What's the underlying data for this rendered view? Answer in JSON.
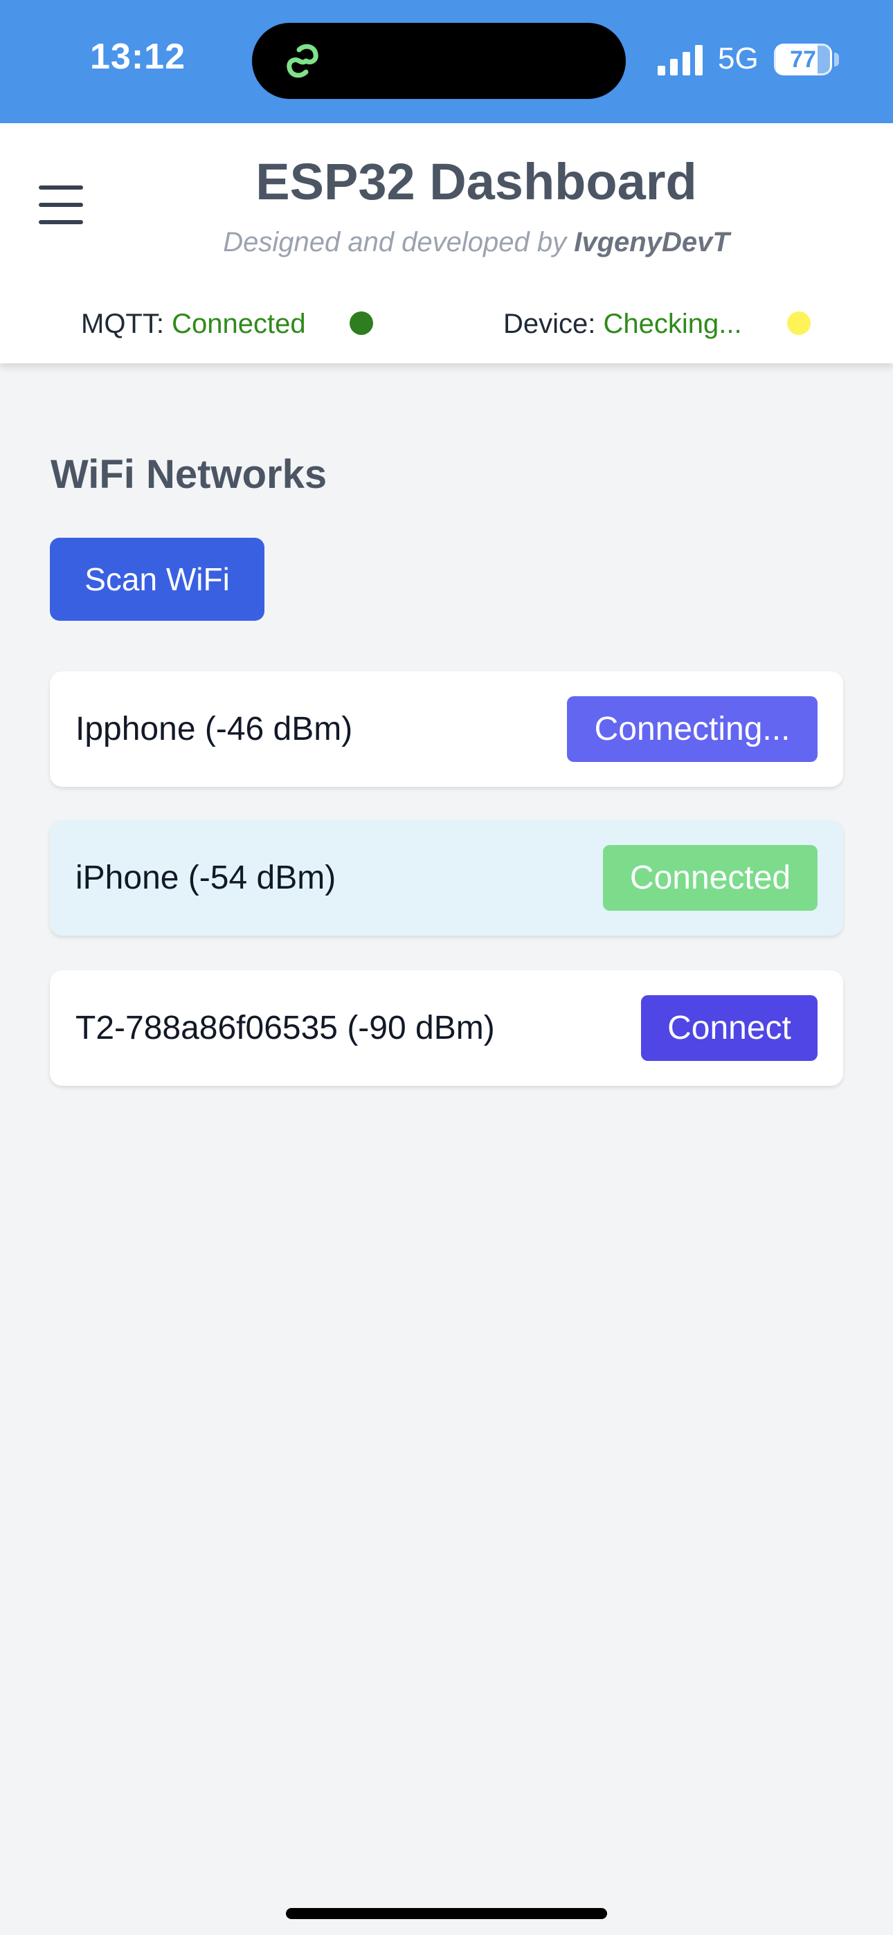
{
  "status_bar": {
    "time": "13:12",
    "network_type": "5G",
    "battery_level": "77",
    "signal_bars": 4,
    "background_color": "#4a94ea",
    "island_icon": "link-icon"
  },
  "header": {
    "title": "ESP32 Dashboard",
    "subtitle_prefix": "Designed and developed by ",
    "subtitle_author": "IvgenyDevT",
    "menu_icon": "hamburger-menu-icon",
    "mqtt": {
      "label": "MQTT: ",
      "value": "Connected",
      "indicator_color": "#2e7d1e"
    },
    "device": {
      "label": "Device: ",
      "value": "Checking...",
      "indicator_color": "#fff35a"
    }
  },
  "wifi": {
    "title": "WiFi Networks",
    "scan_button": "Scan WiFi",
    "networks": [
      {
        "name": "Ipphone (-46 dBm)",
        "action": "Connecting...",
        "button_color": "#6366f1"
      },
      {
        "name": "iPhone (-54 dBm)",
        "action": "Connected",
        "button_color": "#7cdc8c"
      },
      {
        "name": "T2-788a86f06535 (-90 dBm)",
        "action": "Connect",
        "button_color": "#4f46e5"
      }
    ]
  }
}
